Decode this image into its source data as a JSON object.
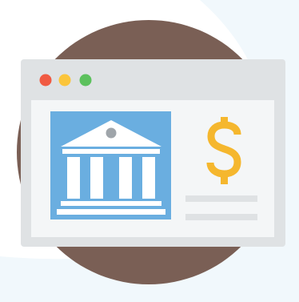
{
  "icon": {
    "name": "online-banking",
    "depicts": [
      "browser-window",
      "bank-building",
      "dollar-sign"
    ]
  },
  "colors": {
    "page_background": "#ffffff",
    "pale_corner": "#f1f8fc",
    "circle": "#7a5f55",
    "window_frame": "#dfe2e4",
    "window_content": "#f4f6f7",
    "traffic_red": "#f05a42",
    "traffic_yellow": "#fbc53b",
    "traffic_green": "#5cc15d",
    "panel_blue": "#6aaee0",
    "building": "#ffffff",
    "building_dot": "#9fa5aa",
    "dollar": "#f5b72e",
    "text_lines": "#dfe2e4"
  }
}
